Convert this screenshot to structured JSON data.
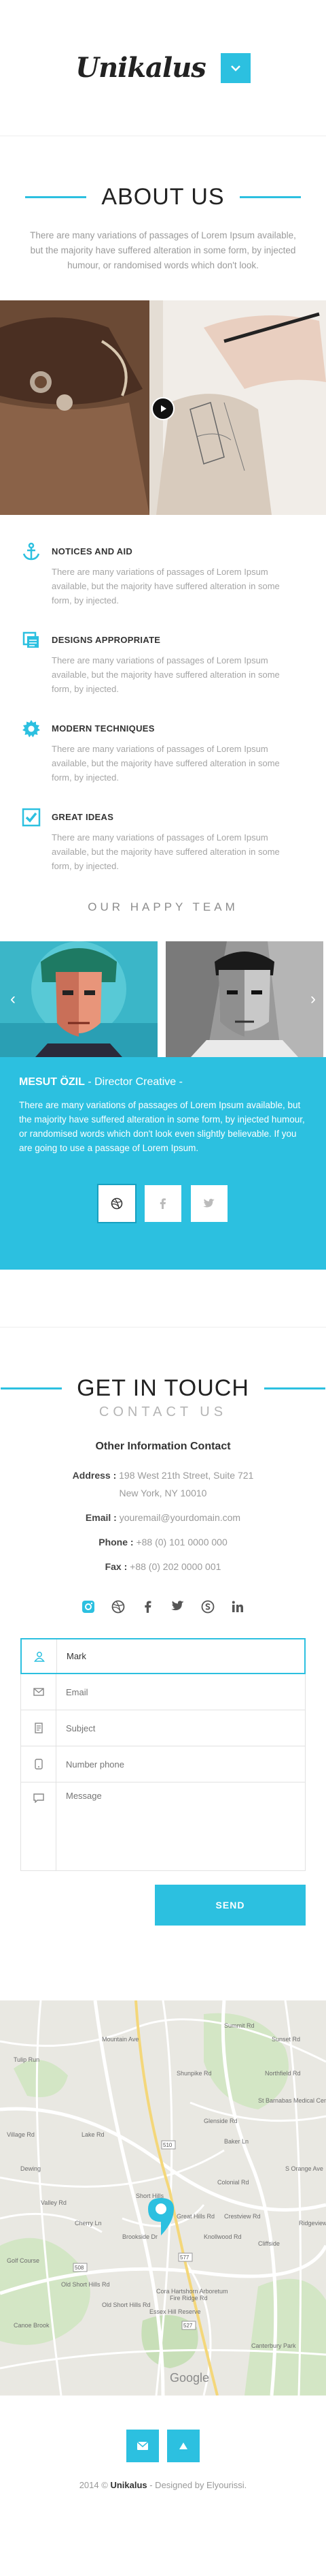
{
  "header": {
    "logo": "Unikalus",
    "menu_icon": "chevron-down-icon"
  },
  "about": {
    "title": "ABOUT US",
    "lead": "There are many variations of passages of Lorem Ipsum available, but the majority have suffered alteration in some form, by injected humour, or randomised words which don't look.",
    "features": [
      {
        "title": "NOTICES AND AID",
        "icon": "anchor-icon",
        "text": "There are many variations of passages of Lorem Ipsum available, but the majority have suffered alteration in some form, by injected."
      },
      {
        "title": "DESIGNS APPROPRIATE",
        "icon": "copy-icon",
        "text": "There are many variations of passages of Lorem Ipsum available, but the majority have suffered alteration in some form, by injected."
      },
      {
        "title": "MODERN TECHNIQUES",
        "icon": "gear-icon",
        "text": "There are many variations of passages of Lorem Ipsum available, but the majority have suffered alteration in some form, by injected."
      },
      {
        "title": "GREAT IDEAS",
        "icon": "checkbox-icon",
        "text": "There are many variations of passages of Lorem Ipsum available, but the majority have suffered alteration in some form, by injected."
      }
    ]
  },
  "team": {
    "title": "OUR HAPPY TEAM",
    "member_name": "MESUT ÖZIL",
    "member_role": " - Director Creative -",
    "member_text": "There are many variations of passages of Lorem Ipsum available, but the majority have suffered alteration in some form, by injected humour, or randomised words which don't look even slightly believable. If you are going to use a passage of Lorem Ipsum."
  },
  "contact": {
    "title": "GET IN TOUCH",
    "subtitle": "CONTACT US",
    "info_title": "Other Information Contact",
    "address_label": "Address :",
    "address_line1": " 198  West 21th Street, Suite 721",
    "address_line2": "New York, NY 10010",
    "email_label": "Email :",
    "email_value": " youremail@yourdomain.com",
    "phone_label": "Phone :",
    "phone_value": " +88 (0) 101 0000 000",
    "fax_label": "Fax :",
    "fax_value": " +88 (0) 202 0000 001"
  },
  "form": {
    "name_value": "Mark",
    "email_placeholder": "Email",
    "subject_placeholder": "Subject",
    "phone_placeholder": "Number phone",
    "message_placeholder": "Message",
    "send_label": "SEND"
  },
  "map": {
    "labels": [
      "Tulip Run",
      "Mountain Ave",
      "Summit Rd",
      "Sunset Rd",
      "Shunpike Rd",
      "Village Rd",
      "Dewing",
      "Glenside Rd",
      "Valley Rd",
      "Cherry Ln",
      "Short Hills",
      "Colonial Rd",
      "Old Short Hills Rd",
      "Canoe Brook",
      "Great Hills Rd",
      "Fire Ridge Rd",
      "Cliffside",
      "St Barnabas Medical Center",
      "Baker Ln",
      "Lake Rd",
      "Golf Course",
      "S Orange Ave",
      "Crestview Rd",
      "Knollwood Rd",
      "Brookside Dr",
      "Cora Hartshorn Arboretum",
      "Old Short Hills Rd",
      "Northfield Rd",
      "Essex Hill Reserve",
      "Canterbury Park",
      "Ridgeview"
    ],
    "route_labels": [
      "510",
      "508",
      "577",
      "527"
    ],
    "brand": "Google"
  },
  "footer": {
    "year": "2014 ©",
    "brand": "Unikalus",
    "credit": " - Designed by Elyourissi."
  },
  "colors": {
    "accent": "#2cc0e0"
  }
}
